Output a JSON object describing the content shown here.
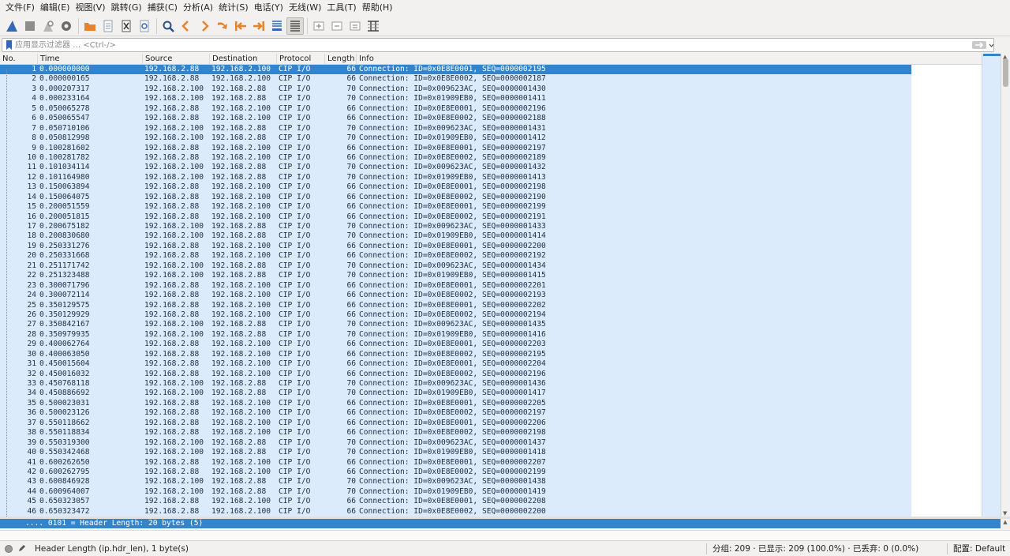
{
  "menu": [
    "文件(F)",
    "编辑(E)",
    "视图(V)",
    "跳转(G)",
    "捕获(C)",
    "分析(A)",
    "统计(S)",
    "电话(Y)",
    "无线(W)",
    "工具(T)",
    "帮助(H)"
  ],
  "filter": {
    "placeholder": "应用显示过滤器 … <Ctrl-/>",
    "value": ""
  },
  "columns": [
    "No.",
    "Time",
    "Source",
    "Destination",
    "Protocol",
    "Length",
    "Info"
  ],
  "packets": [
    [
      "1",
      "0.000000000",
      "192.168.2.88",
      "192.168.2.100",
      "CIP I/O",
      "66",
      "Connection: ID=0x0E8E0001, SEQ=0000002195"
    ],
    [
      "2",
      "0.000000165",
      "192.168.2.88",
      "192.168.2.100",
      "CIP I/O",
      "66",
      "Connection: ID=0x0E8E0002, SEQ=0000002187"
    ],
    [
      "3",
      "0.000207317",
      "192.168.2.100",
      "192.168.2.88",
      "CIP I/O",
      "70",
      "Connection: ID=0x009623AC, SEQ=0000001430"
    ],
    [
      "4",
      "0.000233164",
      "192.168.2.100",
      "192.168.2.88",
      "CIP I/O",
      "70",
      "Connection: ID=0x01909EB0, SEQ=0000001411"
    ],
    [
      "5",
      "0.050065278",
      "192.168.2.88",
      "192.168.2.100",
      "CIP I/O",
      "66",
      "Connection: ID=0x0E8E0001, SEQ=0000002196"
    ],
    [
      "6",
      "0.050065547",
      "192.168.2.88",
      "192.168.2.100",
      "CIP I/O",
      "66",
      "Connection: ID=0x0E8E0002, SEQ=0000002188"
    ],
    [
      "7",
      "0.050710106",
      "192.168.2.100",
      "192.168.2.88",
      "CIP I/O",
      "70",
      "Connection: ID=0x009623AC, SEQ=0000001431"
    ],
    [
      "8",
      "0.050812998",
      "192.168.2.100",
      "192.168.2.88",
      "CIP I/O",
      "70",
      "Connection: ID=0x01909EB0, SEQ=0000001412"
    ],
    [
      "9",
      "0.100281602",
      "192.168.2.88",
      "192.168.2.100",
      "CIP I/O",
      "66",
      "Connection: ID=0x0E8E0001, SEQ=0000002197"
    ],
    [
      "10",
      "0.100281782",
      "192.168.2.88",
      "192.168.2.100",
      "CIP I/O",
      "66",
      "Connection: ID=0x0E8E0002, SEQ=0000002189"
    ],
    [
      "11",
      "0.101034114",
      "192.168.2.100",
      "192.168.2.88",
      "CIP I/O",
      "70",
      "Connection: ID=0x009623AC, SEQ=0000001432"
    ],
    [
      "12",
      "0.101164980",
      "192.168.2.100",
      "192.168.2.88",
      "CIP I/O",
      "70",
      "Connection: ID=0x01909EB0, SEQ=0000001413"
    ],
    [
      "13",
      "0.150063894",
      "192.168.2.88",
      "192.168.2.100",
      "CIP I/O",
      "66",
      "Connection: ID=0x0E8E0001, SEQ=0000002198"
    ],
    [
      "14",
      "0.150064075",
      "192.168.2.88",
      "192.168.2.100",
      "CIP I/O",
      "66",
      "Connection: ID=0x0E8E0002, SEQ=0000002190"
    ],
    [
      "15",
      "0.200051559",
      "192.168.2.88",
      "192.168.2.100",
      "CIP I/O",
      "66",
      "Connection: ID=0x0E8E0001, SEQ=0000002199"
    ],
    [
      "16",
      "0.200051815",
      "192.168.2.88",
      "192.168.2.100",
      "CIP I/O",
      "66",
      "Connection: ID=0x0E8E0002, SEQ=0000002191"
    ],
    [
      "17",
      "0.200675182",
      "192.168.2.100",
      "192.168.2.88",
      "CIP I/O",
      "70",
      "Connection: ID=0x009623AC, SEQ=0000001433"
    ],
    [
      "18",
      "0.200830680",
      "192.168.2.100",
      "192.168.2.88",
      "CIP I/O",
      "70",
      "Connection: ID=0x01909EB0, SEQ=0000001414"
    ],
    [
      "19",
      "0.250331276",
      "192.168.2.88",
      "192.168.2.100",
      "CIP I/O",
      "66",
      "Connection: ID=0x0E8E0001, SEQ=0000002200"
    ],
    [
      "20",
      "0.250331668",
      "192.168.2.88",
      "192.168.2.100",
      "CIP I/O",
      "66",
      "Connection: ID=0x0E8E0002, SEQ=0000002192"
    ],
    [
      "21",
      "0.251171742",
      "192.168.2.100",
      "192.168.2.88",
      "CIP I/O",
      "70",
      "Connection: ID=0x009623AC, SEQ=0000001434"
    ],
    [
      "22",
      "0.251323488",
      "192.168.2.100",
      "192.168.2.88",
      "CIP I/O",
      "70",
      "Connection: ID=0x01909EB0, SEQ=0000001415"
    ],
    [
      "23",
      "0.300071796",
      "192.168.2.88",
      "192.168.2.100",
      "CIP I/O",
      "66",
      "Connection: ID=0x0E8E0001, SEQ=0000002201"
    ],
    [
      "24",
      "0.300072114",
      "192.168.2.88",
      "192.168.2.100",
      "CIP I/O",
      "66",
      "Connection: ID=0x0E8E0002, SEQ=0000002193"
    ],
    [
      "25",
      "0.350129575",
      "192.168.2.88",
      "192.168.2.100",
      "CIP I/O",
      "66",
      "Connection: ID=0x0E8E0001, SEQ=0000002202"
    ],
    [
      "26",
      "0.350129929",
      "192.168.2.88",
      "192.168.2.100",
      "CIP I/O",
      "66",
      "Connection: ID=0x0E8E0002, SEQ=0000002194"
    ],
    [
      "27",
      "0.350842167",
      "192.168.2.100",
      "192.168.2.88",
      "CIP I/O",
      "70",
      "Connection: ID=0x009623AC, SEQ=0000001435"
    ],
    [
      "28",
      "0.350979935",
      "192.168.2.100",
      "192.168.2.88",
      "CIP I/O",
      "70",
      "Connection: ID=0x01909EB0, SEQ=0000001416"
    ],
    [
      "29",
      "0.400062764",
      "192.168.2.88",
      "192.168.2.100",
      "CIP I/O",
      "66",
      "Connection: ID=0x0E8E0001, SEQ=0000002203"
    ],
    [
      "30",
      "0.400063050",
      "192.168.2.88",
      "192.168.2.100",
      "CIP I/O",
      "66",
      "Connection: ID=0x0E8E0002, SEQ=0000002195"
    ],
    [
      "31",
      "0.450015604",
      "192.168.2.88",
      "192.168.2.100",
      "CIP I/O",
      "66",
      "Connection: ID=0x0E8E0001, SEQ=0000002204"
    ],
    [
      "32",
      "0.450016032",
      "192.168.2.88",
      "192.168.2.100",
      "CIP I/O",
      "66",
      "Connection: ID=0x0E8E0002, SEQ=0000002196"
    ],
    [
      "33",
      "0.450768118",
      "192.168.2.100",
      "192.168.2.88",
      "CIP I/O",
      "70",
      "Connection: ID=0x009623AC, SEQ=0000001436"
    ],
    [
      "34",
      "0.450886692",
      "192.168.2.100",
      "192.168.2.88",
      "CIP I/O",
      "70",
      "Connection: ID=0x01909EB0, SEQ=0000001417"
    ],
    [
      "35",
      "0.500023031",
      "192.168.2.88",
      "192.168.2.100",
      "CIP I/O",
      "66",
      "Connection: ID=0x0E8E0001, SEQ=0000002205"
    ],
    [
      "36",
      "0.500023126",
      "192.168.2.88",
      "192.168.2.100",
      "CIP I/O",
      "66",
      "Connection: ID=0x0E8E0002, SEQ=0000002197"
    ],
    [
      "37",
      "0.550118662",
      "192.168.2.88",
      "192.168.2.100",
      "CIP I/O",
      "66",
      "Connection: ID=0x0E8E0001, SEQ=0000002206"
    ],
    [
      "38",
      "0.550118834",
      "192.168.2.88",
      "192.168.2.100",
      "CIP I/O",
      "66",
      "Connection: ID=0x0E8E0002, SEQ=0000002198"
    ],
    [
      "39",
      "0.550319300",
      "192.168.2.100",
      "192.168.2.88",
      "CIP I/O",
      "70",
      "Connection: ID=0x009623AC, SEQ=0000001437"
    ],
    [
      "40",
      "0.550342468",
      "192.168.2.100",
      "192.168.2.88",
      "CIP I/O",
      "70",
      "Connection: ID=0x01909EB0, SEQ=0000001418"
    ],
    [
      "41",
      "0.600262650",
      "192.168.2.88",
      "192.168.2.100",
      "CIP I/O",
      "66",
      "Connection: ID=0x0E8E0001, SEQ=0000002207"
    ],
    [
      "42",
      "0.600262795",
      "192.168.2.88",
      "192.168.2.100",
      "CIP I/O",
      "66",
      "Connection: ID=0x0E8E0002, SEQ=0000002199"
    ],
    [
      "43",
      "0.600846928",
      "192.168.2.100",
      "192.168.2.88",
      "CIP I/O",
      "70",
      "Connection: ID=0x009623AC, SEQ=0000001438"
    ],
    [
      "44",
      "0.600964007",
      "192.168.2.100",
      "192.168.2.88",
      "CIP I/O",
      "70",
      "Connection: ID=0x01909EB0, SEQ=0000001419"
    ],
    [
      "45",
      "0.650323057",
      "192.168.2.88",
      "192.168.2.100",
      "CIP I/O",
      "66",
      "Connection: ID=0x0E8E0001, SEQ=0000002208"
    ],
    [
      "46",
      "0.650323472",
      "192.168.2.88",
      "192.168.2.100",
      "CIP I/O",
      "66",
      "Connection: ID=0x0E8E0002, SEQ=0000002200"
    ]
  ],
  "selected_packet": "1",
  "details": {
    "selected_line": ".... 0101 = Header Length: 20 bytes (5)"
  },
  "status": {
    "field": "Header Length (ip.hdr_len), 1 byte(s)",
    "packets": "分组: 209 · 已显示: 209 (100.0%) · 已丢弃: 0 (0.0%)",
    "profile": "配置:  Default"
  },
  "colors": {
    "row_bg": "#dbebfb",
    "selected_bg": "#3584c9",
    "shark_fin": "#3566b7"
  },
  "toolbar_icons": [
    "shark-fin-start-icon",
    "stop-capture-icon",
    "restart-capture-icon",
    "capture-options-icon",
    "open-file-icon",
    "save-file-icon",
    "close-file-icon",
    "reload-file-icon",
    "find-packet-icon",
    "go-back-icon",
    "go-forward-icon",
    "go-to-packet-icon",
    "go-first-icon",
    "go-last-icon",
    "autoscroll-icon",
    "colorize-icon",
    "zoom-in-icon",
    "zoom-out-icon",
    "normal-size-icon",
    "resize-columns-icon"
  ]
}
